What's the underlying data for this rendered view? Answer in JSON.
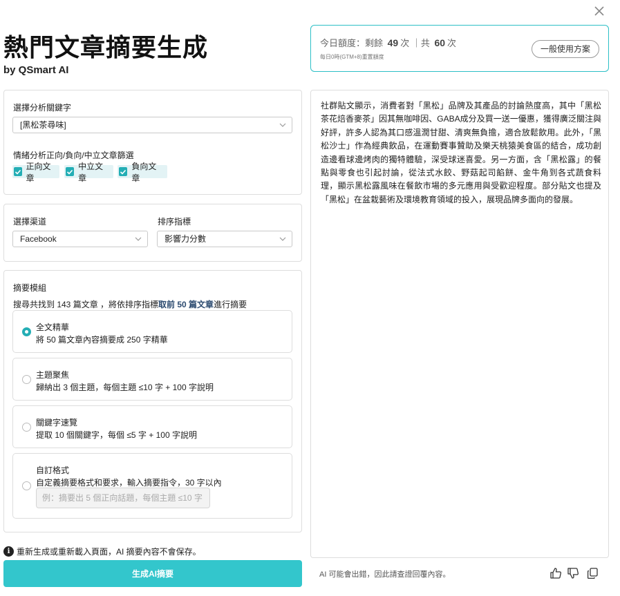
{
  "title": "熱門文章摘要生成",
  "byline": "by QSmart AI",
  "quota": {
    "prefix": "今日額度：剩餘",
    "remaining": "49",
    "unit1": "次 ｜共",
    "total": "60",
    "unit2": "次",
    "reset_note": "每日0時(GTM+8)重置額度",
    "plan_button": "一般使用方案"
  },
  "keyword": {
    "label": "選擇分析關鍵字",
    "value": "[黑松茶尋味]"
  },
  "sentiment": {
    "label": "情緒分析正向/負向/中立文章篩選",
    "options": [
      {
        "label": "正向文章",
        "checked": true
      },
      {
        "label": "中立文章",
        "checked": true
      },
      {
        "label": "負向文章",
        "checked": true
      }
    ]
  },
  "channel": {
    "label": "選擇渠道",
    "value": "Facebook"
  },
  "sort": {
    "label": "排序指標",
    "value": "影響力分數"
  },
  "summary": {
    "label": "摘要模組",
    "info_prefix": "搜尋共找到 143 篇文章 ，將依排序指標",
    "info_highlight": "取前 50 篇文章",
    "info_suffix": "進行摘要",
    "options": [
      {
        "title": "全文精華",
        "desc": "將 50 篇文章內容摘要成 250 字精華",
        "selected": true
      },
      {
        "title": "主題聚焦",
        "desc": "歸納出 3 個主題，每個主題 ≤10 字 + 100 字說明",
        "selected": false
      },
      {
        "title": "關鍵字速覽",
        "desc": "提取 10 個關鍵字，每個 ≤5 字 + 100 字說明",
        "selected": false
      },
      {
        "title": "自訂格式",
        "desc": "自定義摘要格式和要求，輸入摘要指令，30 字以內",
        "selected": false,
        "placeholder": "例：摘要出 5 個正向話題，每個主題 ≤10 字 +..."
      }
    ]
  },
  "notice": "重新生成或重新載入頁面，AI 摘要內容不會保存。",
  "generate_button": "生成AI摘要",
  "output_text": "社群貼文顯示，消費者對「黑松」品牌及其產品的討論熱度高，其中「黑松茶花焙香麥茶」因其無咖啡因、GABA成分及買一送一優惠，獲得廣泛關注與好評，許多人認為其口感溫潤甘甜、清爽無負擔，適合放鬆飲用。此外，「黑松沙士」作為經典飲品，在運動賽事贊助及樂天桃猿美食區的結合，成功創造邊看球邊烤肉的獨特體驗，深受球迷喜愛。另一方面，含「黑松露」的餐點與零食也引起討論，從法式水餃、野菇起司餡餅、金牛角到各式蔬食料理，顯示黑松露風味在餐飲市場的多元應用與受歡迎程度。部分貼文也提及「黑松」在盆栽藝術及環境教育領域的投入，展現品牌多面向的發展。",
  "footer_note": "AI 可能會出錯，因此請查證回覆內容。",
  "icons": {
    "close": "close-icon",
    "chevron": "chevron-down-icon",
    "check": "check-icon",
    "info": "info-icon",
    "thumbs_up": "thumbs-up-icon",
    "thumbs_down": "thumbs-down-icon",
    "copy": "copy-icon"
  },
  "colors": {
    "accent": "#33c6cc",
    "checkbox": "#24aeb5",
    "checkbox_bg": "#e3f3f5",
    "highlight_text": "#2b4a6f"
  }
}
